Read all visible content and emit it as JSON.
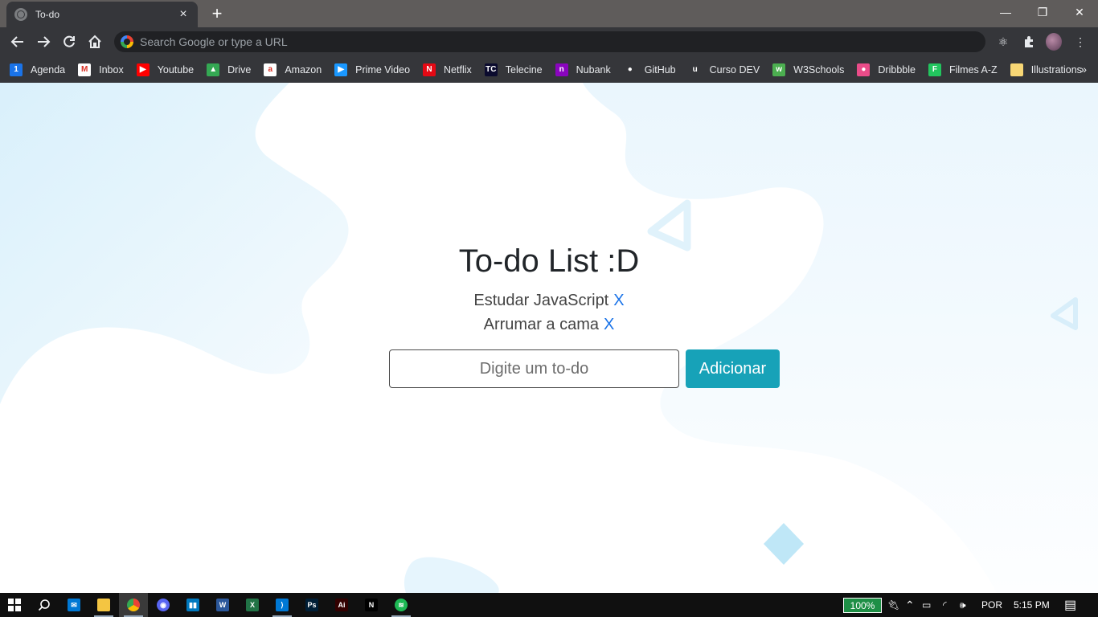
{
  "browser": {
    "tab": {
      "title": "To-do",
      "close_icon": "×"
    },
    "new_tab_icon": "+",
    "window_controls": {
      "minimize": "—",
      "restore": "❐",
      "close": "✕"
    },
    "omnibox": {
      "placeholder": "Search Google or type a URL"
    }
  },
  "bookmarks": [
    {
      "label": "Agenda",
      "icon": "calendar-icon",
      "color": "#1a73e8",
      "glyph": "1"
    },
    {
      "label": "Inbox",
      "icon": "gmail-icon",
      "color": "#ffffff",
      "glyph": "M"
    },
    {
      "label": "Youtube",
      "icon": "youtube-icon",
      "color": "#ff0000",
      "glyph": "▶"
    },
    {
      "label": "Drive",
      "icon": "drive-icon",
      "color": "#34a853",
      "glyph": "▲"
    },
    {
      "label": "Amazon",
      "icon": "amazon-icon",
      "color": "#ffffff",
      "glyph": "a"
    },
    {
      "label": "Prime Video",
      "icon": "prime-video-icon",
      "color": "#1a98ff",
      "glyph": "▶"
    },
    {
      "label": "Netflix",
      "icon": "netflix-icon",
      "color": "#e50914",
      "glyph": "N"
    },
    {
      "label": "Telecine",
      "icon": "telecine-icon",
      "color": "#0b0b2e",
      "glyph": "TC"
    },
    {
      "label": "Nubank",
      "icon": "nubank-icon",
      "color": "#8a05be",
      "glyph": "n"
    },
    {
      "label": "GitHub",
      "icon": "github-icon",
      "color": "#35363a",
      "glyph": "●"
    },
    {
      "label": "Curso DEV",
      "icon": "curso-dev-icon",
      "color": "#35363a",
      "glyph": "u"
    },
    {
      "label": "W3Schools",
      "icon": "w3schools-icon",
      "color": "#4caf50",
      "glyph": "w"
    },
    {
      "label": "Dribbble",
      "icon": "dribbble-icon",
      "color": "#ea4c89",
      "glyph": "●"
    },
    {
      "label": "Filmes A-Z",
      "icon": "filmes-icon",
      "color": "#22c55e",
      "glyph": "F"
    },
    {
      "label": "Illustrations",
      "icon": "folder-icon",
      "color": "#f8d775",
      "glyph": ""
    }
  ],
  "page": {
    "heading": "To-do List :D",
    "todos": [
      {
        "text": "Estudar JavaScript",
        "remove": "X"
      },
      {
        "text": "Arrumar a cama",
        "remove": "X"
      }
    ],
    "input": {
      "placeholder": "Digite um to-do",
      "value": ""
    },
    "add_button": "Adicionar",
    "colors": {
      "button": "#17a2b8",
      "remove_link": "#1a73e8",
      "blob": "#e6f5fd"
    }
  },
  "taskbar": {
    "apps": [
      {
        "name": "mail-icon",
        "color": "#0078d4",
        "glyph": "✉"
      },
      {
        "name": "file-explorer-icon",
        "color": "#f4c542",
        "glyph": ""
      },
      {
        "name": "chrome-icon",
        "color": "#4285f4",
        "glyph": ""
      },
      {
        "name": "discord-icon",
        "color": "#5865f2",
        "glyph": "◉"
      },
      {
        "name": "trello-icon",
        "color": "#0079bf",
        "glyph": "▮▮"
      },
      {
        "name": "word-icon",
        "color": "#2b579a",
        "glyph": "W"
      },
      {
        "name": "excel-icon",
        "color": "#217346",
        "glyph": "X"
      },
      {
        "name": "vscode-icon",
        "color": "#0078d4",
        "glyph": "⟩"
      },
      {
        "name": "photoshop-icon",
        "color": "#001e36",
        "glyph": "Ps"
      },
      {
        "name": "illustrator-icon",
        "color": "#330000",
        "glyph": "Ai"
      },
      {
        "name": "netflix-app-icon",
        "color": "#000000",
        "glyph": "N"
      },
      {
        "name": "spotify-icon",
        "color": "#1db954",
        "glyph": "≋"
      }
    ],
    "battery": "100%",
    "language": "POR",
    "time": "5:15 PM"
  }
}
